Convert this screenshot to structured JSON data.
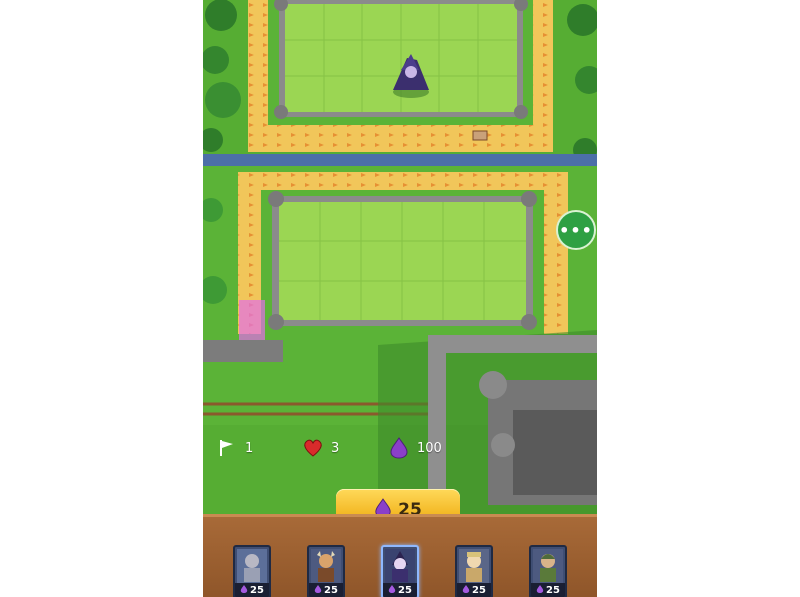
{
  "stats": {
    "flags": "1",
    "hearts": "3",
    "mana": "100"
  },
  "mana_button": {
    "cost": "25"
  },
  "cards": [
    {
      "name": "knight-card",
      "cost": "25",
      "selected": false
    },
    {
      "name": "viking-card",
      "cost": "25",
      "selected": false
    },
    {
      "name": "mage-card",
      "cost": "25",
      "selected": true
    },
    {
      "name": "warrior-card",
      "cost": "25",
      "selected": false
    },
    {
      "name": "archer-card",
      "cost": "25",
      "selected": false
    }
  ],
  "colors": {
    "grass": "#56ad33",
    "field": "#8ccf4a",
    "path": "#f1c65a",
    "arrow": "#e58a2f",
    "stone": "#8b8b8b",
    "river": "#4c6fa8",
    "gold": "#f3b824",
    "gem": "#8a3fc9"
  },
  "icons": [
    "flag-icon",
    "heart-icon",
    "mana-gem-icon",
    "more-icon"
  ]
}
